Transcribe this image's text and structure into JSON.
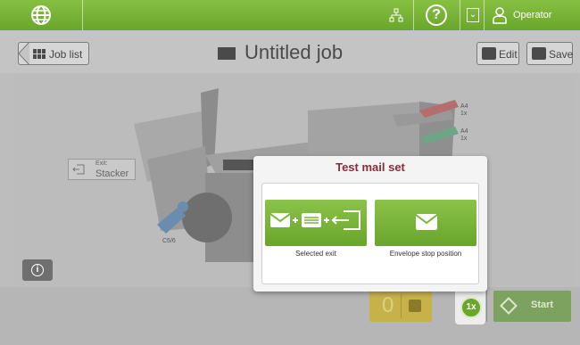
{
  "topbar": {
    "operator_label": "Operator"
  },
  "header": {
    "job_list_label": "Job list",
    "title": "Untitled job",
    "edit_label": "Edit",
    "save_label": "Save"
  },
  "canvas": {
    "exit_label_small": "Exit:",
    "exit_label": "Stacker",
    "envelope_tray_label": "C5/6",
    "tray1_label": "A4",
    "tray1_count": "1x",
    "tray2_label": "A4",
    "tray2_count": "1x"
  },
  "bottom": {
    "counter_value": "0",
    "start_label": "Start",
    "repeat_label": "1x"
  },
  "dialog": {
    "title": "Test mail set",
    "options": [
      {
        "label": "Selected exit",
        "icon": "envelope-insert-exit-icon"
      },
      {
        "label": "Envelope stop position",
        "icon": "envelope-icon"
      }
    ]
  },
  "colors": {
    "accent_green": "#6aa62b",
    "dialog_title": "#8a2b3a",
    "counter_yellow": "#c7b24a"
  }
}
